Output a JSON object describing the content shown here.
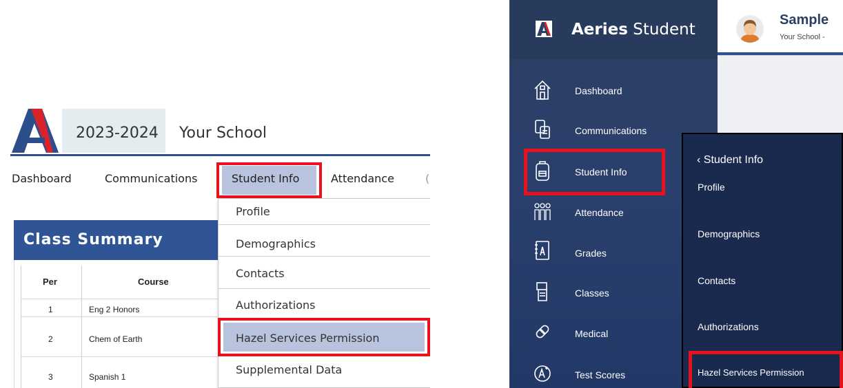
{
  "left": {
    "year": "2023-2024",
    "school": "Your School",
    "nav": {
      "dashboard": "Dashboard",
      "communications": "Communications",
      "student_info": "Student Info",
      "attendance": "Attendance"
    },
    "class_summary": {
      "title": "Class Summary",
      "headers": {
        "per": "Per",
        "course": "Course"
      },
      "rows": [
        {
          "per": "1",
          "course": "Eng 2 Honors"
        },
        {
          "per": "2",
          "course": "Chem of Earth"
        },
        {
          "per": "3",
          "course": "Spanish 1"
        }
      ]
    },
    "dropdown": [
      "Profile",
      "Demographics",
      "Contacts",
      "Authorizations",
      "Hazel Services Permission",
      "Supplemental Data"
    ]
  },
  "right": {
    "brand_bold": "Aeries",
    "brand_rest": " Student",
    "user_name": "Sample",
    "user_school": "Your School -",
    "nav": [
      "Dashboard",
      "Communications",
      "Student Info",
      "Attendance",
      "Grades",
      "Classes",
      "Medical",
      "Test Scores"
    ],
    "flyout": {
      "title": "‹ Student Info",
      "items": [
        "Profile",
        "Demographics",
        "Contacts",
        "Authorizations",
        "Hazel Services Permission"
      ]
    }
  },
  "colors": {
    "highlight_red": "#e8121e",
    "nav_blue": "#2f5597",
    "sidebar_navy": "#2a3f6c",
    "menu_highlight": "#b8c4dd"
  }
}
